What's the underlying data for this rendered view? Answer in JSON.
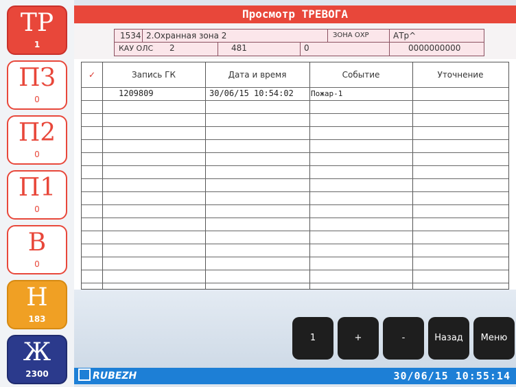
{
  "sidebar": {
    "buttons": [
      {
        "label": "ТР",
        "count": "1"
      },
      {
        "label": "ПЗ",
        "count": "0"
      },
      {
        "label": "П2",
        "count": "0"
      },
      {
        "label": "П1",
        "count": "0"
      },
      {
        "label": "В",
        "count": "0"
      },
      {
        "label": "Н",
        "count": "183"
      },
      {
        "label": "Ж",
        "count": "2300"
      }
    ]
  },
  "header": {
    "title": "Просмотр ТРЕВОГА"
  },
  "info": {
    "zone_num": "1534",
    "zone_name": "2.Охранная зона 2",
    "zone_type": "ЗОНА ОХР",
    "state": "АТр^",
    "device": "КАУ ОЛС",
    "device_num": "2",
    "address": "481",
    "value": "0",
    "code": "0000000000"
  },
  "table": {
    "columns": [
      "✓",
      "Запись ГК",
      "Дата и время",
      "Событие",
      "Уточнение"
    ],
    "rows": [
      [
        "",
        "1209809",
        "30/06/15 10:54:02",
        "Пожар-1",
        ""
      ]
    ]
  },
  "buttons": {
    "page": "1",
    "plus": "+",
    "minus": "-",
    "back": "Назад",
    "menu": "Меню"
  },
  "status": {
    "logo": "RUBEZH",
    "datetime": "30/06/15 10:55:14"
  },
  "colors": {
    "accent_red": "#e8473a",
    "orange": "#f0a024",
    "navy": "#2b3a8c",
    "status_blue": "#1d7fd6"
  }
}
